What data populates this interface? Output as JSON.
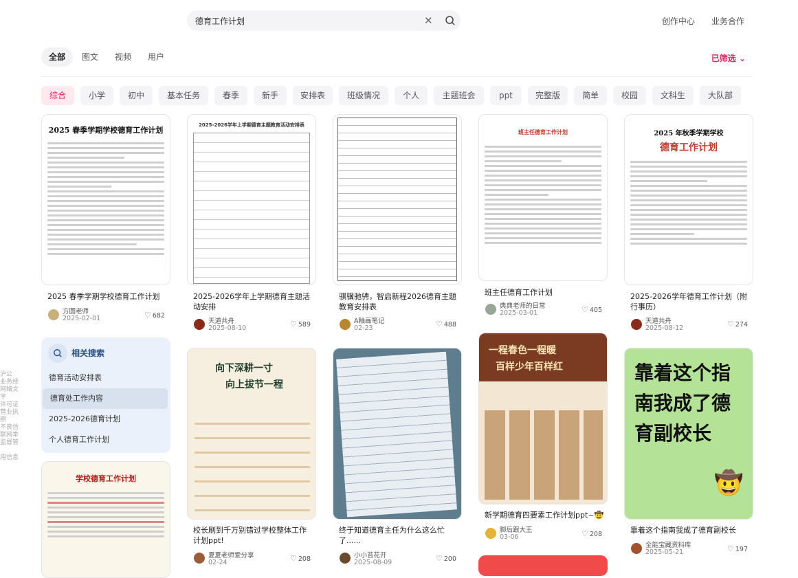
{
  "search": {
    "query": "德育工作计划"
  },
  "header": {
    "links": [
      "创作中心",
      "业务合作"
    ]
  },
  "tabs": [
    "全部",
    "图文",
    "视频",
    "用户"
  ],
  "filter_label": "已筛选",
  "chips": [
    "综合",
    "小学",
    "初中",
    "基本任务",
    "春季",
    "新手",
    "安排表",
    "班级情况",
    "个人",
    "主题班会",
    "ppt",
    "完整版",
    "简单",
    "校园",
    "文科生",
    "大队部"
  ],
  "related": {
    "title": "相关搜索",
    "items": [
      "德育活动安排表",
      "德育处工作内容",
      "2025-2026德育计划",
      "个人德育工作计划"
    ]
  },
  "side_text": [
    "沪公",
    "业务经",
    "网络文",
    "字",
    "许可证",
    "营业执照",
    "不良信",
    "联网举",
    "监督管",
    "",
    "用信息"
  ],
  "cards": [
    {
      "title": "2025 春季学期学校德育工作计划",
      "author": "方圆老师",
      "date": "2025-02-01",
      "likes": "682",
      "thumb_text": "2025 春季学期学校德育工作计划"
    },
    {
      "title": "2025-2026学年上学期德育主题活动安排",
      "author": "天道共舟",
      "date": "2025-08-10",
      "likes": "589",
      "thumb_text": "2025-2026学年上学期德育主题教育活动安排表"
    },
    {
      "title": "骐骥驰骋，智启新程2026德育主题教育安排表",
      "author": "A釉画笔记",
      "date": "02-23",
      "likes": "488",
      "thumb_text": ""
    },
    {
      "title": "班主任德育工作计划",
      "author": "典典老师的日常",
      "date": "2025-03-01",
      "likes": "405",
      "thumb_text": "班主任德育工作计划"
    },
    {
      "title": "2025-2026学年德育工作计划（附行事历）",
      "author": "天道共舟",
      "date": "2025-08-12",
      "likes": "274",
      "thumb_text": "2025 年秋季学期学校",
      "thumb_text2": "德育工作计划"
    },
    {
      "title": "校长刷到千万别错过学校整体工作计划ppt!",
      "author": "夏夏老师爱分享",
      "date": "02-24",
      "likes": "208",
      "thumb_text": "向下深耕一寸",
      "thumb_text2": "向上拔节一程"
    },
    {
      "title": "终于知道德育主任为什么这么忙了......",
      "author": "小小苔花开",
      "date": "2025-08-09",
      "likes": "200"
    },
    {
      "title": "新学期德育四要素工作计划ppt~🤠",
      "author": "脚后跟大王",
      "date": "03-06",
      "likes": "208",
      "thumb_text": "一程春色一程暖",
      "thumb_text2": "百样少年百样红"
    },
    {
      "title": "靠着这个指南我成了德育副校长",
      "author": "全能宝藏资料库",
      "date": "2025-05-21",
      "likes": "197",
      "thumb_text": "靠着这个指南我成了德育副校长"
    },
    {
      "thumb_text": "学校德育工作计划"
    }
  ],
  "colors": {
    "accent": "#e0245e",
    "related_bg": "#eaf1fb",
    "green_card": "#b4e398"
  }
}
